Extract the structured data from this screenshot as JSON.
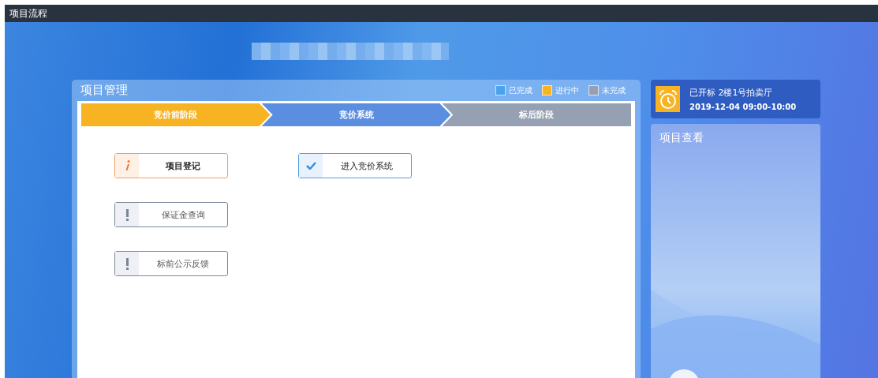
{
  "window": {
    "title": "项目流程"
  },
  "panel": {
    "title": "项目管理",
    "legend": [
      {
        "label": "已完成",
        "color": "#4aa3ee"
      },
      {
        "label": "进行中",
        "color": "#f8b323"
      },
      {
        "label": "未完成",
        "color": "#95a1b3"
      }
    ],
    "stages": [
      {
        "label": "竞价前阶段",
        "kind": "active"
      },
      {
        "label": "竞价系统",
        "kind": "done"
      },
      {
        "label": "标后阶段",
        "kind": "pending"
      }
    ],
    "action_columns": [
      [
        {
          "label": "项目登记",
          "kind": "info"
        },
        {
          "label": "保证金查询",
          "kind": "warn"
        },
        {
          "label": "标前公示反馈",
          "kind": "warn"
        }
      ],
      [
        {
          "label": "进入竞价系统",
          "kind": "check"
        }
      ]
    ]
  },
  "notice": {
    "status": "已开标 2楼1号拍卖厅",
    "time": "2019-12-04 09:00-10:00"
  },
  "side_card": {
    "title": "项目查看"
  }
}
